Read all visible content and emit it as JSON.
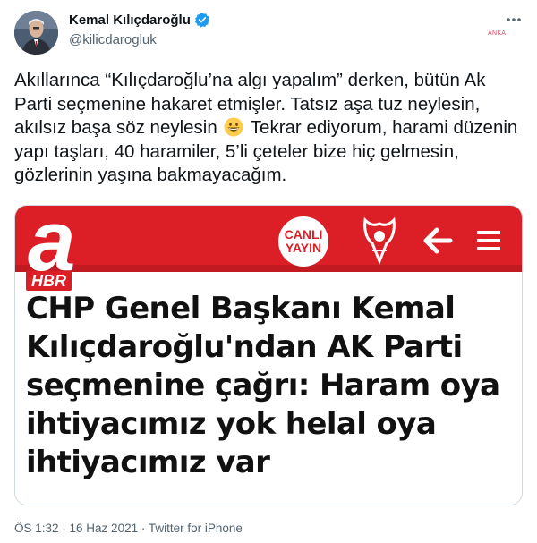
{
  "author": {
    "display_name": "Kemal Kılıçdaroğlu",
    "handle": "@kilicdarogluk",
    "verified": true
  },
  "watermark": "ANKA",
  "tweet": {
    "text_before_emoji": "Akıllarınca “Kılıçdaroğlu’na algı yapalım” derken, bütün Ak Parti seçmenine hakaret etmişler. Tatsız aşa tuz neylesin, akılsız başa söz neylesin",
    "emoji": "grinning-face",
    "text_after_emoji": " Tekrar ediyorum, harami düzenin yapı taşları, 40 haramiler, 5’li çeteler bize hiç gelmesin, gözlerinin yaşına bakmayacağım."
  },
  "media": {
    "logo_letter": "a",
    "logo_sub": "HBR",
    "live_badge_line1": "CANLI",
    "live_badge_line2": "YAYIN",
    "headline": "CHP Genel Başkanı Kemal Kılıçdaroğlu'ndan AK Parti seçmenine çağrı: Haram oya ihtiyacımız yok helal oya ihtiyacımız var",
    "brand_color": "#dc1f26"
  },
  "meta": {
    "time": "ÖS 1:32",
    "separator": " · ",
    "date": "16 Haz 2021",
    "source": "Twitter for iPhone"
  },
  "colors": {
    "verified": "#1d9bf0",
    "secondary_text": "#536471"
  }
}
